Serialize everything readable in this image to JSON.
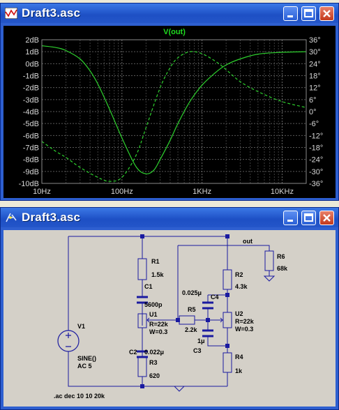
{
  "plot_window": {
    "title": "Draft3.asc",
    "trace_label": "V(out)"
  },
  "schematic_window": {
    "title": "Draft3.asc",
    "net_out": "out",
    "components": {
      "r1": {
        "ref": "R1",
        "value": "1.5k"
      },
      "c1": {
        "ref": "C1",
        "value": "5600p"
      },
      "u1": {
        "ref": "U1",
        "r": "R=22k",
        "w": "W=0.3"
      },
      "c2": {
        "ref": "C2",
        "value": "0.022μ"
      },
      "r3": {
        "ref": "R3",
        "value": "620"
      },
      "r5": {
        "ref": "R5",
        "value": "2.2k"
      },
      "c4": {
        "ref": "C4",
        "value": "0.025μ"
      },
      "c3": {
        "ref": "C3",
        "value": "1μ"
      },
      "r2": {
        "ref": "R2",
        "value": "4.3k"
      },
      "u2": {
        "ref": "U2",
        "r": "R=22k",
        "w": "W=0.3"
      },
      "r4": {
        "ref": "R4",
        "value": "1k"
      },
      "r6": {
        "ref": "R6",
        "value": "68k"
      },
      "v1": {
        "ref": "V1",
        "func": "SINE()",
        "ac": "AC 5"
      }
    },
    "directive": ".ac dec 10 10 20k"
  },
  "chart_data": {
    "type": "line",
    "title": "V(out)",
    "x_scale": "log",
    "xlim": [
      10,
      20000
    ],
    "x_ticks": [
      "10Hz",
      "100Hz",
      "1KHz",
      "10KHz"
    ],
    "y_left_ticks": [
      "2dB",
      "1dB",
      "0dB",
      "-1dB",
      "-2dB",
      "-3dB",
      "-4dB",
      "-5dB",
      "-6dB",
      "-7dB",
      "-8dB",
      "-9dB",
      "-10dB"
    ],
    "y_right_ticks": [
      "36°",
      "30°",
      "24°",
      "18°",
      "12°",
      "6°",
      "0°",
      "-6°",
      "-12°",
      "-18°",
      "-24°",
      "-30°",
      "-36°"
    ],
    "ylim_left": [
      -10,
      2
    ],
    "ylim_right": [
      -36,
      36
    ],
    "grid": true,
    "series": [
      {
        "name": "V(out)",
        "axis": "magnitude_dB",
        "style": "solid",
        "x": [
          10,
          15,
          20,
          30,
          40,
          50,
          70,
          100,
          150,
          200,
          250,
          300,
          400,
          500,
          700,
          1000,
          1500,
          2000,
          3000,
          5000,
          10000,
          20000
        ],
        "y": [
          1.5,
          1.35,
          1.1,
          0.4,
          -0.6,
          -1.7,
          -3.8,
          -6.2,
          -8.6,
          -9.2,
          -8.9,
          -8.0,
          -6.4,
          -5.0,
          -3.2,
          -1.8,
          -0.7,
          -0.1,
          0.4,
          0.8,
          0.95,
          1.0
        ]
      },
      {
        "name": "V(out)",
        "axis": "phase_deg",
        "style": "dashed",
        "x": [
          10,
          15,
          20,
          30,
          50,
          70,
          100,
          150,
          200,
          300,
          400,
          500,
          700,
          1000,
          1500,
          2000,
          3000,
          5000,
          10000,
          20000
        ],
        "y": [
          -15,
          -20,
          -23,
          -28,
          -33,
          -35,
          -33,
          -22,
          -8,
          12,
          22,
          27,
          30,
          29,
          25,
          21,
          15,
          10,
          5,
          2
        ]
      }
    ]
  }
}
